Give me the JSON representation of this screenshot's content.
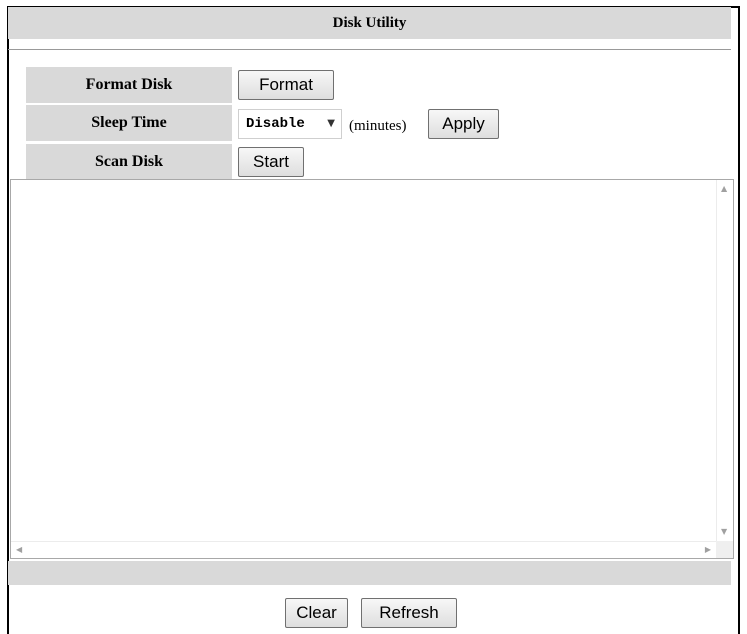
{
  "title": "Disk Utility",
  "rows": {
    "format": {
      "label": "Format Disk",
      "button": "Format"
    },
    "sleep": {
      "label": "Sleep Time",
      "select_value": "Disable",
      "units": "(minutes)",
      "button": "Apply"
    },
    "scan": {
      "label": "Scan Disk",
      "button": "Start"
    }
  },
  "log": {
    "value": ""
  },
  "footer": {
    "clear_label": "Clear",
    "refresh_label": "Refresh"
  },
  "icons": {
    "dropdown": "chevron-down-icon",
    "scroll_up": "scroll-up-arrow-icon",
    "scroll_down": "scroll-down-arrow-icon",
    "scroll_left": "scroll-left-arrow-icon",
    "scroll_right": "scroll-right-arrow-icon"
  },
  "colors": {
    "header_bg": "#d9d9d9",
    "border": "#000000"
  }
}
